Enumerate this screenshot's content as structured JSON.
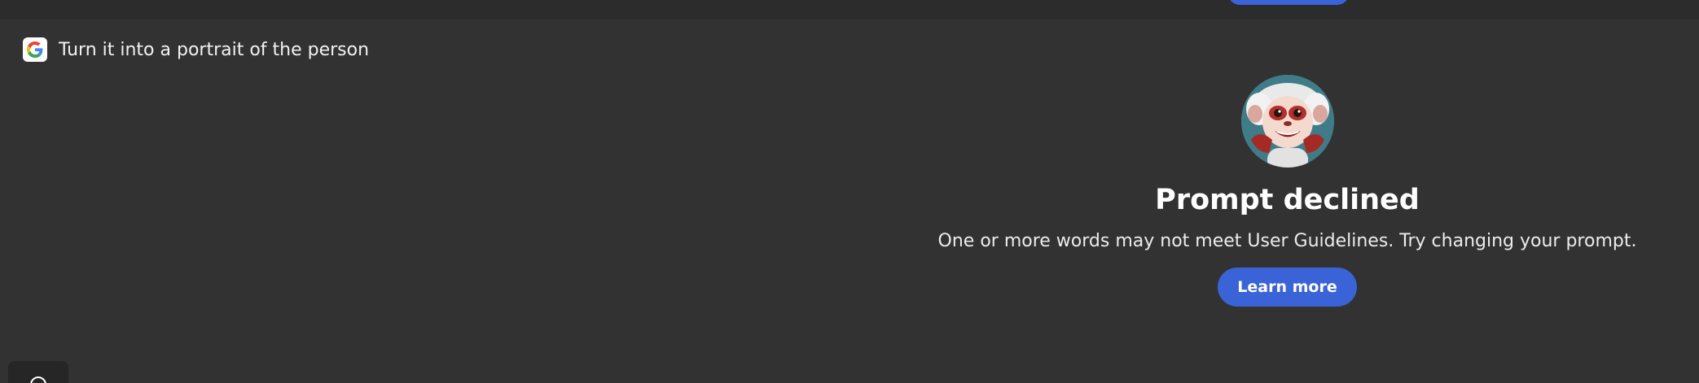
{
  "prompt": {
    "engine_icon": "google-g-icon",
    "text": "Turn it into a portrait of the person"
  },
  "declined": {
    "avatar_icon": "monkey-mascot-icon",
    "title": "Prompt declined",
    "message": "One or more words may not meet User Guidelines. Try changing your prompt.",
    "learn_more_label": "Learn more"
  },
  "corner": {
    "icon": "help-icon"
  },
  "colors": {
    "background": "#323232",
    "top_strip": "#2c2c2c",
    "accent": "#3b63d8",
    "text": "#ffffff"
  }
}
